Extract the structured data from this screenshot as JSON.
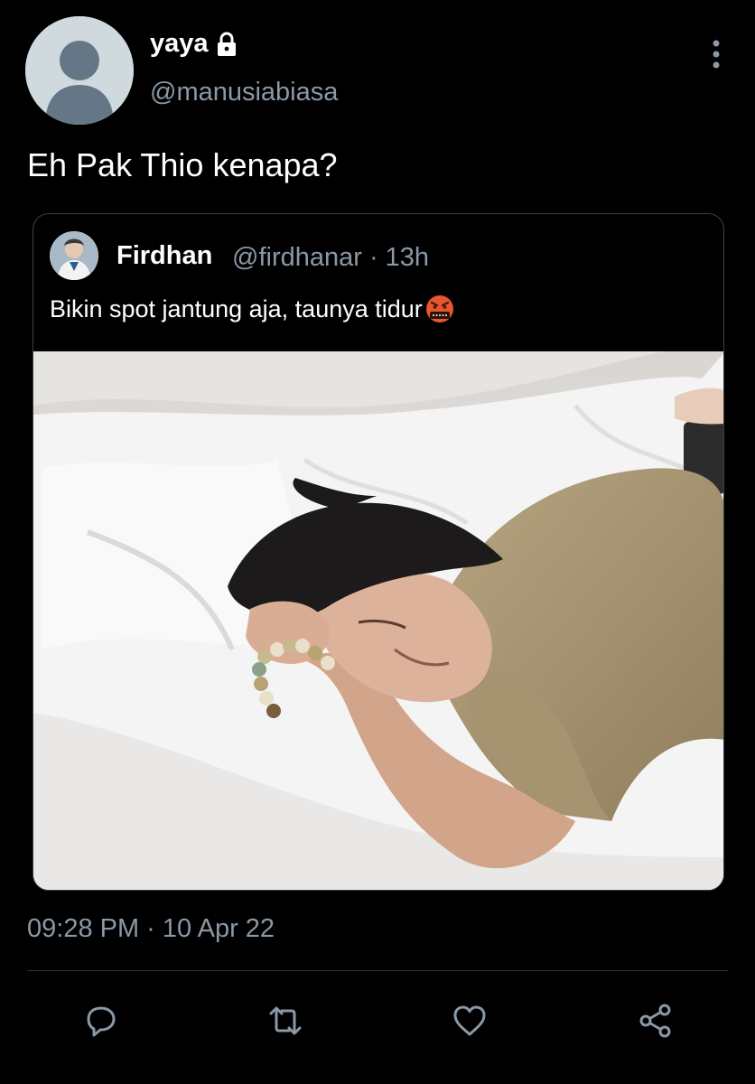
{
  "tweet": {
    "display_name": "yaya",
    "handle": "@manusiabiasa",
    "text": "Eh Pak Thio kenapa?",
    "timestamp": "09:28 PM · 10 Apr 22",
    "protected_icon": "lock-icon"
  },
  "quoted": {
    "display_name": "Firdhan",
    "handle": "@firdhanar · 13h",
    "text": "Bikin spot jantung aja, taunya tidur",
    "emoji": "face-with-symbols-on-mouth"
  },
  "actions": [
    {
      "icon": "reply-icon"
    },
    {
      "icon": "retweet-icon"
    },
    {
      "icon": "like-icon"
    },
    {
      "icon": "share-icon"
    }
  ],
  "colors": {
    "background": "#000000",
    "text": "#ffffff",
    "secondary_text": "#8b98a5",
    "border": "#3e4144"
  }
}
